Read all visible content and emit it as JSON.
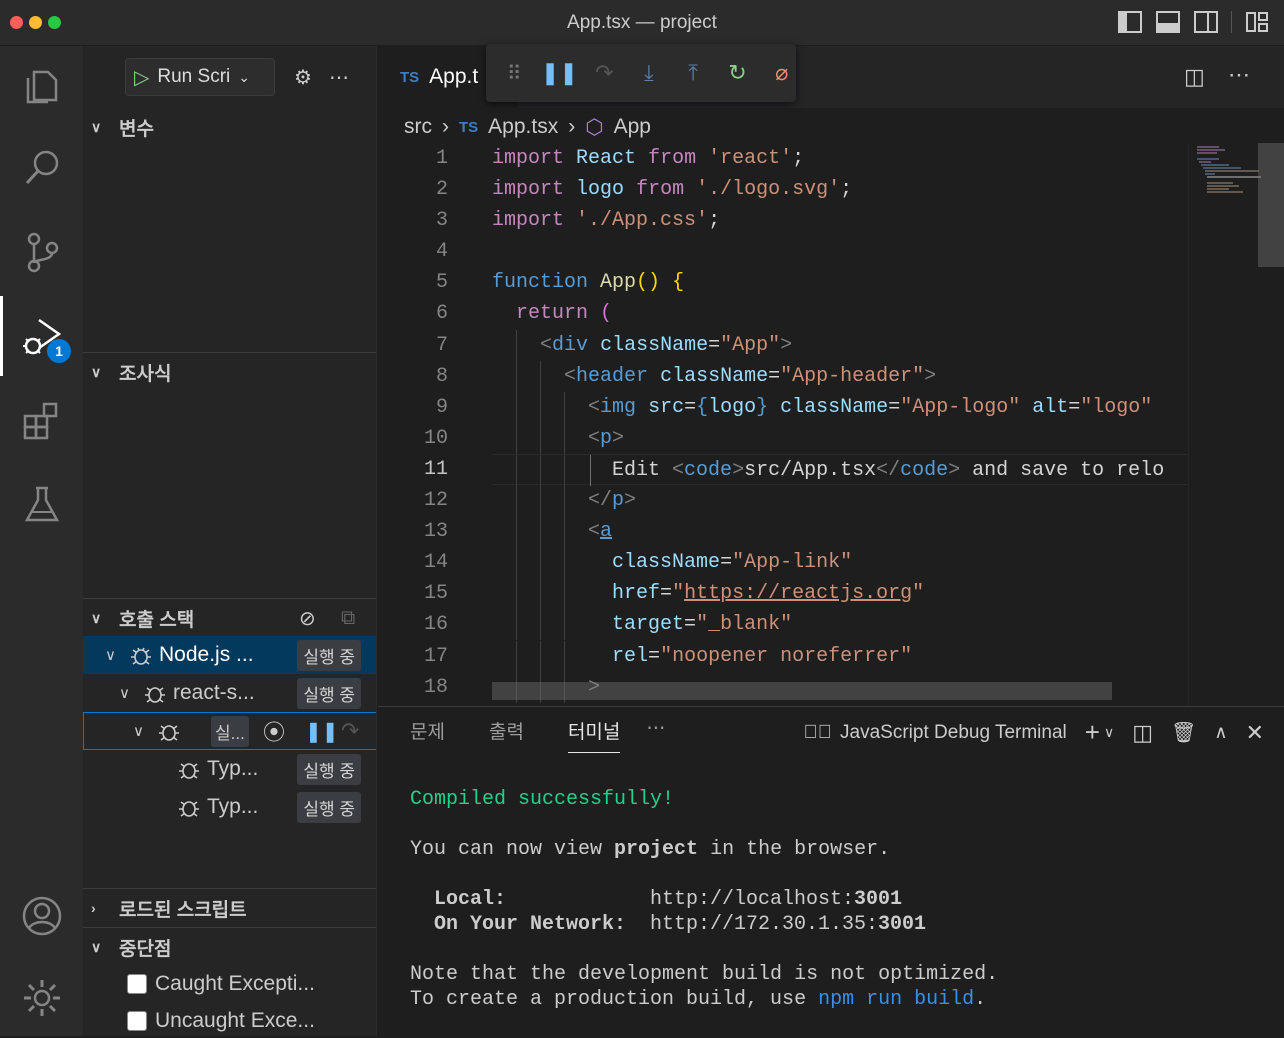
{
  "window": {
    "title": "App.tsx — project"
  },
  "activity_bar": {
    "debug_badge": "1"
  },
  "sidebar": {
    "run_config": "Run Scri",
    "sections": {
      "variables": "변수",
      "watch": "조사식",
      "call_stack": "호출 스택",
      "loaded_scripts": "로드된 스크립트",
      "breakpoints": "중단점"
    },
    "call_stack": [
      {
        "name": "Node.js ...",
        "status": "실행 중"
      },
      {
        "name": "react-s...",
        "status": "실행 중"
      },
      {
        "name": "",
        "status": "실..."
      },
      {
        "name": "Typ...",
        "status": "실행 중"
      },
      {
        "name": "Typ...",
        "status": "실행 중"
      }
    ],
    "breakpoints": [
      "Caught Excepti...",
      "Uncaught Exce..."
    ]
  },
  "editor": {
    "tab": "App.t",
    "tab_lang": "TS",
    "breadcrumb": {
      "folder": "src",
      "file": "App.tsx",
      "symbol": "App"
    },
    "line_numbers": [
      "1",
      "2",
      "3",
      "4",
      "5",
      "6",
      "7",
      "8",
      "9",
      "10",
      "11",
      "12",
      "13",
      "14",
      "15",
      "16",
      "17",
      "18"
    ],
    "current_line": "11"
  },
  "panel": {
    "tabs": [
      "문제",
      "출력",
      "터미널"
    ],
    "active_tab": "터미널",
    "terminal_name": "JavaScript Debug Terminal",
    "output": {
      "compiled": "Compiled successfully!",
      "view_pre": "You can now view ",
      "view_project": "project",
      "view_post": " in the browser.",
      "local_label": "  Local:",
      "local_host": "http://localhost:",
      "local_port": "3001",
      "network_label": "  On Your Network:",
      "network_host": "http://172.30.1.35:",
      "network_port": "3001",
      "note1": "Note that the development build is not optimized.",
      "note2_pre": "To create a production build, use ",
      "note2_cmd": "npm run build",
      "note2_post": "."
    }
  },
  "colors": {
    "accent": "#0078d4",
    "success": "#23d18b",
    "link": "#3b8eea"
  }
}
